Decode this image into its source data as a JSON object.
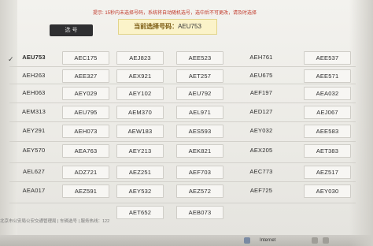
{
  "notice": "提示: 15秒内未选择号码，系统将自动随机选号，选中后不可更改，请及时选择",
  "select_button": "选 号",
  "current": {
    "label": "当前选择号码：",
    "value": "AEU753"
  },
  "plates": [
    [
      "AEU753",
      "AEC175",
      "AEJ823",
      "AEE523",
      "AEH761",
      "AEE537"
    ],
    [
      "AEH263",
      "AEE327",
      "AEX921",
      "AET257",
      "AEU675",
      "AEE571"
    ],
    [
      "AEH063",
      "AEY029",
      "AEY102",
      "AEU792",
      "AEF197",
      "AEA032"
    ],
    [
      "AEM313",
      "AEU795",
      "AEM370",
      "AEL971",
      "AED127",
      "AEJ067"
    ],
    [
      "AEY291",
      "AEH073",
      "AEW183",
      "AES593",
      "AEY032",
      "AEE583"
    ],
    [
      "AEY570",
      "AEA763",
      "AEY213",
      "AEK821",
      "AEX205",
      "AET383"
    ],
    [
      "AEL627",
      "ADZ721",
      "AEZ251",
      "AEF703",
      "AEC773",
      "AEZ517"
    ],
    [
      "AEA017",
      "AEZ591",
      "AEY532",
      "AEZ572",
      "AEF725",
      "AEY030"
    ],
    [
      "",
      "",
      "AET652",
      "AEB073",
      "",
      ""
    ]
  ],
  "selected": "AEU753",
  "footer": "北京市公安局公安交通管理局 | 车辆选号 | 服务热线：122",
  "taskbar_label": "Internet",
  "colors": {
    "notice": "#c0392b",
    "current_bg": "#fbf3c9",
    "button_bg": "#2f2f31"
  }
}
